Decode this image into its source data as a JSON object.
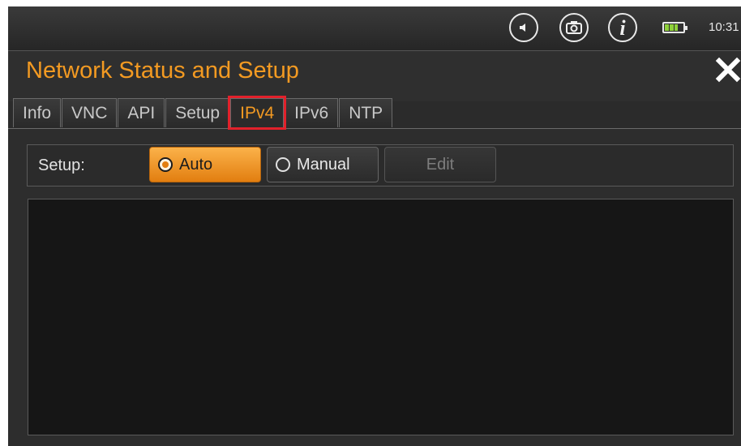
{
  "statusbar": {
    "icons": [
      "speaker-icon",
      "camera-icon",
      "info-icon",
      "battery-icon"
    ],
    "info_glyph": "i",
    "battery_level": 0.75,
    "clock": "10:31"
  },
  "window": {
    "title": "Network Status and Setup",
    "close_icon": "close-icon"
  },
  "tabs": [
    {
      "label": "Info"
    },
    {
      "label": "VNC"
    },
    {
      "label": "API"
    },
    {
      "label": "Setup"
    },
    {
      "label": "IPv4",
      "active": true
    },
    {
      "label": "IPv6"
    },
    {
      "label": "NTP"
    }
  ],
  "setup": {
    "label": "Setup:",
    "auto_label": "Auto",
    "manual_label": "Manual",
    "edit_label": "Edit",
    "selected": "Auto"
  },
  "colors": {
    "accent": "#f39a22",
    "highlight": "#e2212b",
    "battery": "#8fd13a"
  }
}
